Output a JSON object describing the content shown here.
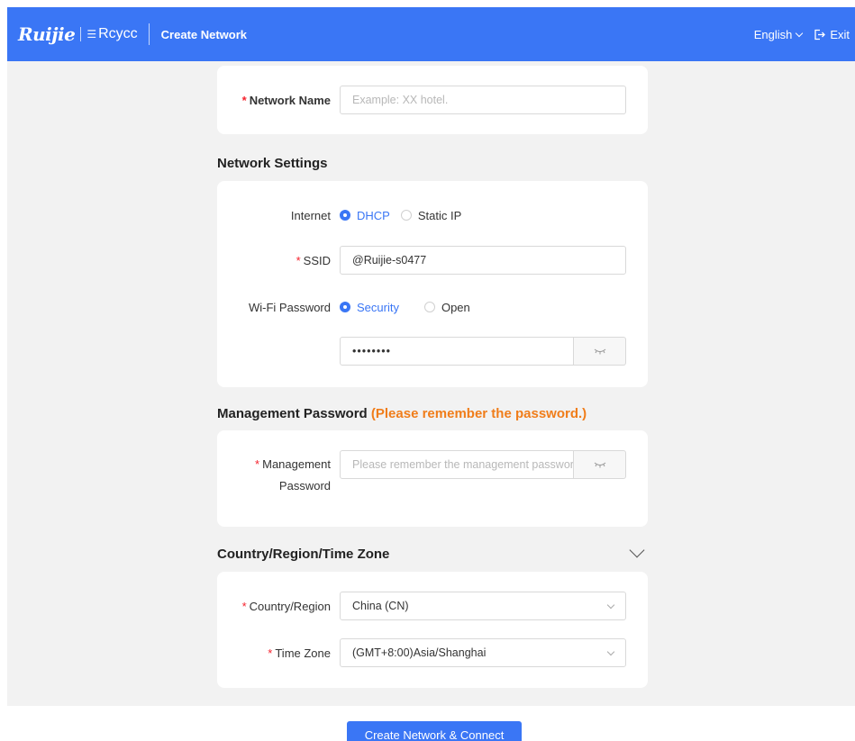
{
  "header": {
    "logo_ruijie": "Ruijie",
    "logo_reyee": "Rcycc",
    "title": "Create Network",
    "language": "English",
    "exit_label": "Exit",
    "color": "#3a76f5"
  },
  "network_name": {
    "label": "Network Name",
    "placeholder": "Example: XX hotel."
  },
  "network_settings": {
    "title": "Network Settings",
    "internet_label": "Internet",
    "internet_options": [
      "DHCP",
      "Static IP"
    ],
    "internet_selected": "DHCP",
    "ssid_label": "SSID",
    "ssid_value": "@Ruijie-s0477",
    "wifi_password_label": "Wi-Fi Password",
    "wifi_options": [
      "Security",
      "Open"
    ],
    "wifi_selected": "Security",
    "wifi_password_value": "••••••••"
  },
  "management": {
    "title": "Management Password",
    "warning": "(Please remember the password.)",
    "label_line1": "Management",
    "label_line2": "Password",
    "placeholder": "Please remember the management password."
  },
  "region": {
    "title": "Country/Region/Time Zone",
    "country_label": "Country/Region",
    "country_value": "China (CN)",
    "timezone_label": "Time Zone",
    "timezone_value": "(GMT+8:00)Asia/Shanghai"
  },
  "submit_label": "Create Network & Connect",
  "colors": {
    "accent": "#3a76f5",
    "warning": "#f07d1a",
    "required": "#f5222d"
  }
}
